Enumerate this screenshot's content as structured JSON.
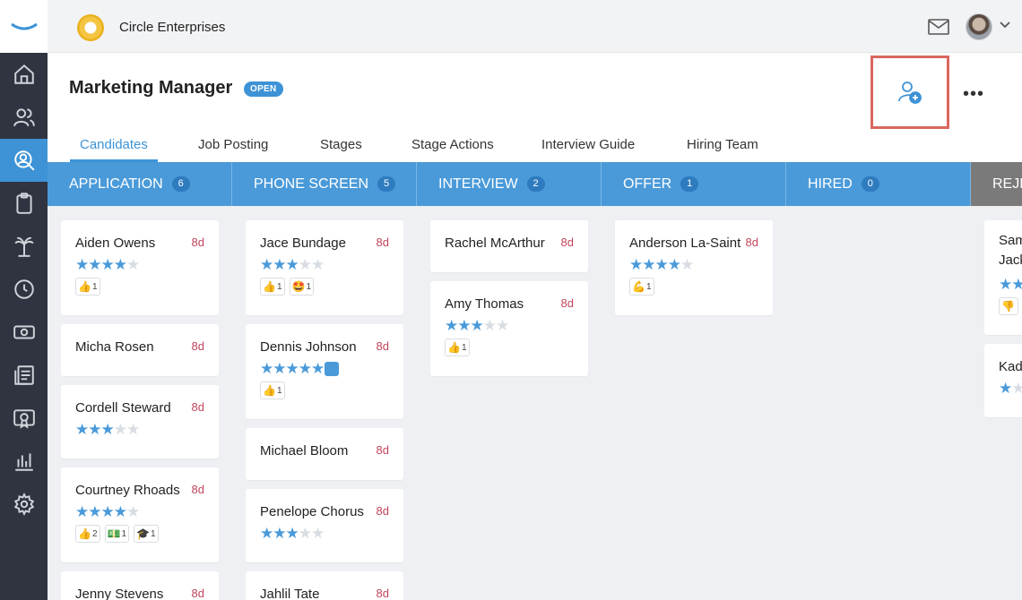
{
  "topbar": {
    "company_name": "Circle Enterprises"
  },
  "job": {
    "title": "Marketing Manager",
    "status": "OPEN"
  },
  "tabs": [
    "Candidates",
    "Job Posting",
    "Stages",
    "Stage Actions",
    "Interview Guide",
    "Hiring Team"
  ],
  "stages": [
    {
      "label": "APPLICATION",
      "count": "6"
    },
    {
      "label": "PHONE SCREEN",
      "count": "5"
    },
    {
      "label": "INTERVIEW",
      "count": "2"
    },
    {
      "label": "OFFER",
      "count": "1"
    },
    {
      "label": "HIRED",
      "count": "0"
    },
    {
      "label": "REJE",
      "count": ""
    }
  ],
  "columns": [
    [
      {
        "name": "Aiden Owens",
        "age": "8d",
        "stars": 3.5,
        "reactions": [
          {
            "emoji": "👍",
            "count": "1"
          }
        ]
      },
      {
        "name": "Micha Rosen",
        "age": "8d",
        "stars": 0,
        "reactions": []
      },
      {
        "name": "Cordell Steward",
        "age": "8d",
        "stars": 3,
        "reactions": []
      },
      {
        "name": "Courtney Rhoads",
        "age": "8d",
        "stars": 4,
        "reactions": [
          {
            "emoji": "👍",
            "count": "2"
          },
          {
            "emoji": "💵",
            "count": "1"
          },
          {
            "emoji": "🎓",
            "count": "1"
          }
        ]
      },
      {
        "name": "Jenny Stevens",
        "age": "8d",
        "stars": 0,
        "reactions": []
      }
    ],
    [
      {
        "name": "Jace Bundage",
        "age": "8d",
        "stars": 3,
        "reactions": [
          {
            "emoji": "👍",
            "count": "1"
          },
          {
            "emoji": "🤩",
            "count": "1"
          }
        ]
      },
      {
        "name": "Dennis Johnson",
        "age": "8d",
        "stars": 5,
        "reactions": [
          {
            "emoji": "👍",
            "count": "1"
          }
        ],
        "profile": true
      },
      {
        "name": "Michael Bloom",
        "age": "8d",
        "stars": 0,
        "reactions": []
      },
      {
        "name": "Penelope Chorus",
        "age": "8d",
        "stars": 3,
        "reactions": []
      },
      {
        "name": "Jahlil Tate",
        "age": "8d",
        "stars": 0,
        "reactions": []
      }
    ],
    [
      {
        "name": "Rachel McArthur",
        "age": "8d",
        "stars": 0,
        "reactions": []
      },
      {
        "name": "Amy Thomas",
        "age": "8d",
        "stars": 3,
        "reactions": [
          {
            "emoji": "👍",
            "count": "1"
          }
        ]
      }
    ],
    [
      {
        "name": "Anderson La-Saint",
        "age": "8d",
        "stars": 4,
        "reactions": [
          {
            "emoji": "💪",
            "count": "1"
          }
        ]
      }
    ],
    [],
    [
      {
        "name": "Sam Jack",
        "age": "",
        "stars": 2,
        "reactions": [
          {
            "emoji": "👎",
            "count": ""
          }
        ]
      },
      {
        "name": "Kad",
        "age": "",
        "stars": 1,
        "reactions": []
      }
    ]
  ]
}
